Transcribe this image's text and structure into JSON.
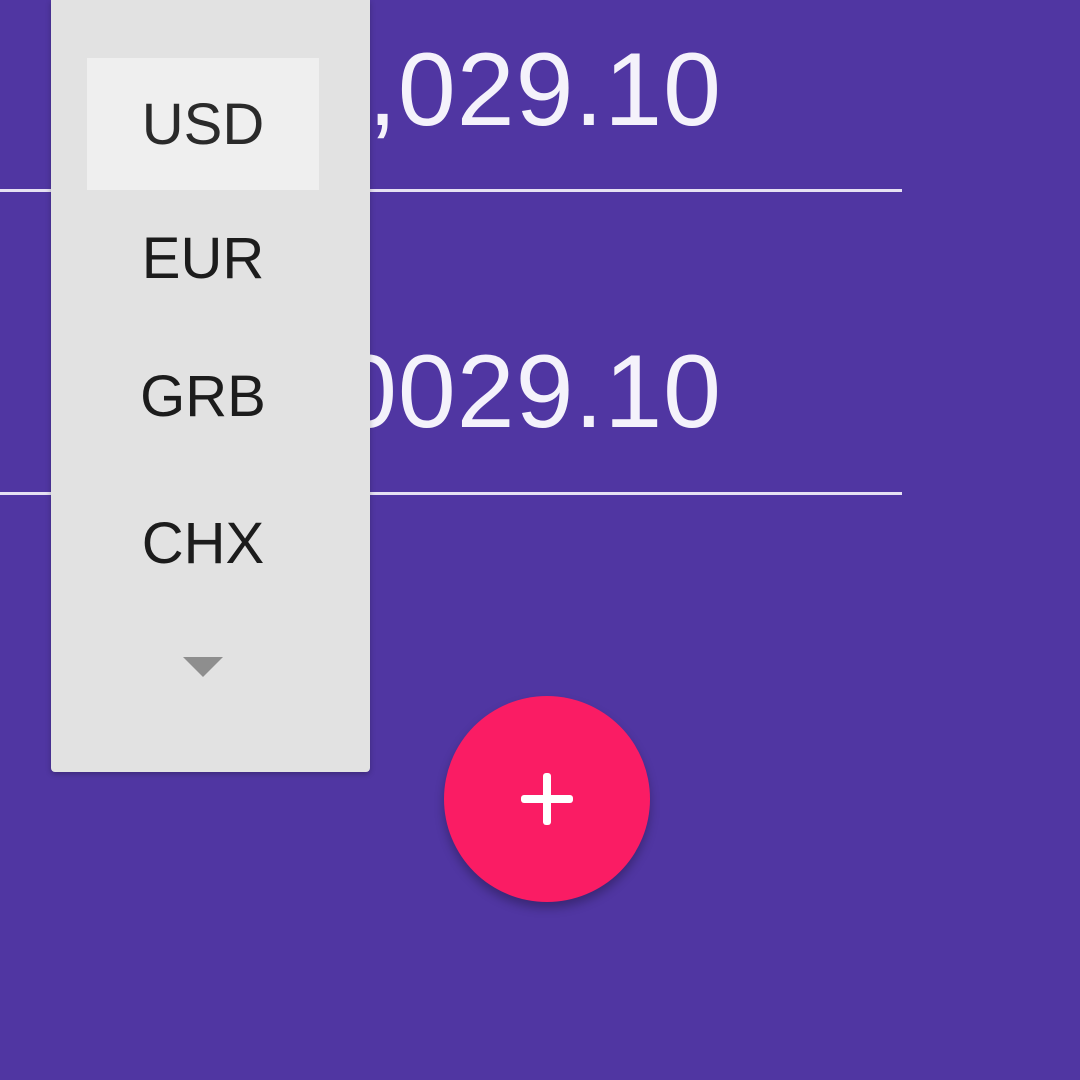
{
  "app": {
    "background_color": "#5036a2",
    "accent_color": "#fa1c64"
  },
  "amounts": [
    {
      "value": ",029.10"
    },
    {
      "value": "0029.10"
    }
  ],
  "fab": {
    "icon": "plus-icon"
  },
  "currency_dropdown": {
    "selected": "USD",
    "options": [
      "USD",
      "EUR",
      "GRB",
      "CHX"
    ],
    "more_icon": "triangle-down-icon"
  }
}
